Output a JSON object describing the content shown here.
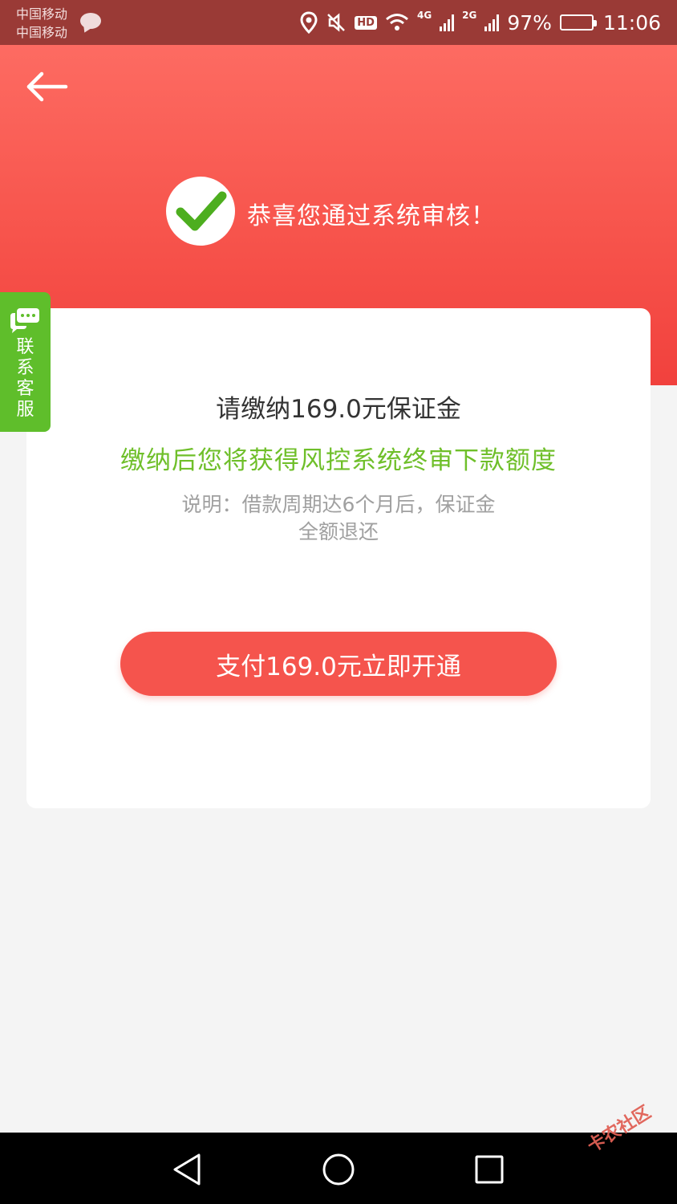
{
  "status_bar": {
    "carrier_1": "中国移动",
    "carrier_2": "中国移动",
    "network_1": "4G",
    "network_2": "2G",
    "hd_badge": "HD",
    "battery_percent": "97%",
    "battery_level": 0.97,
    "time": "11:06",
    "icons": [
      "message-icon",
      "location-icon",
      "mute-icon",
      "hd-icon",
      "wifi-icon",
      "signal-icon",
      "battery-icon"
    ]
  },
  "header": {
    "back_icon": "arrow-left-icon",
    "success_icon": "check-circle-icon",
    "success_message": "恭喜您通过系统审核！",
    "colors": {
      "gradient_top": "#fd6b62",
      "gradient_bottom": "#f1413d"
    }
  },
  "side_tab": {
    "icon": "chat-icon",
    "chars": [
      "联",
      "系",
      "客",
      "服"
    ],
    "color": "#5fbe2b"
  },
  "card": {
    "amount_title": "请缴纳169.0元保证金",
    "highlight_text": "缴纳后您将获得风控系统终审下款额度",
    "note_line_1": "说明：借款周期达6个月后，保证金",
    "note_line_2": "全额退还",
    "pay_button_label": "支付169.0元立即开通",
    "colors": {
      "accent_green": "#6fbf2a",
      "button_red": "#f5544d"
    }
  },
  "nav_bar": {
    "icons": [
      "nav-back-icon",
      "nav-home-icon",
      "nav-recent-icon"
    ],
    "watermark": "卡农社区"
  }
}
